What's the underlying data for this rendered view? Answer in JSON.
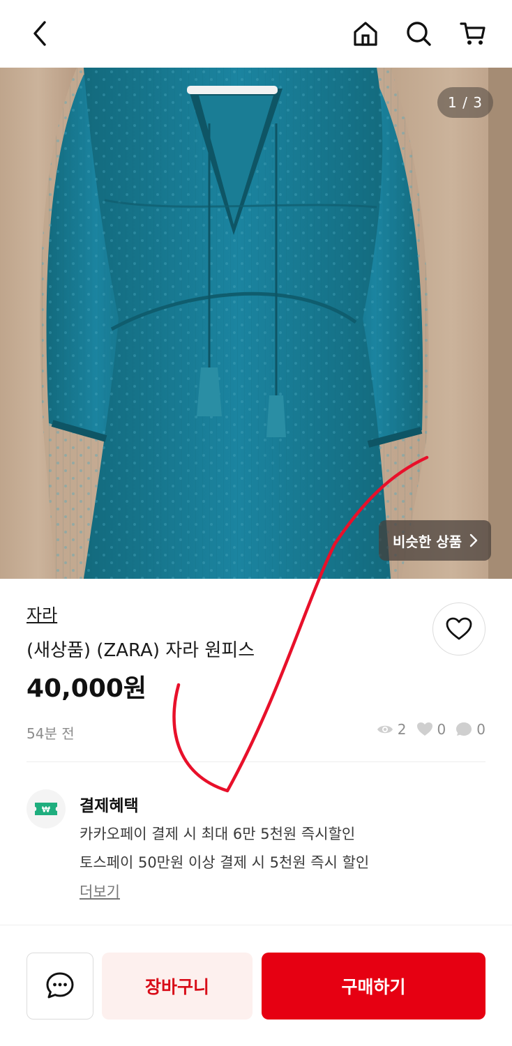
{
  "header": {
    "back_icon": "chevron-left-icon",
    "home_icon": "home-icon",
    "search_icon": "search-icon",
    "cart_icon": "cart-icon"
  },
  "gallery": {
    "counter": "1 / 3",
    "similar_label": "비슷한 상품",
    "similar_icon": "chevron-right-icon"
  },
  "product": {
    "brand": "자라",
    "title": "(새상품) (ZARA) 자라 원피스",
    "price": "40,000원",
    "posted": "54분 전",
    "views": "2",
    "likes": "0",
    "chats": "0"
  },
  "benefits": {
    "title": "결제혜택",
    "line1": "카카오페이 결제 시 최대 6만 5천원 즉시할인",
    "line2": "토스페이 50만원 이상 결제 시 5천원 즉시 할인",
    "more": "더보기"
  },
  "actions": {
    "cart_label": "장바구니",
    "buy_label": "구매하기"
  },
  "colors": {
    "accent": "#e60012",
    "cart_bg": "#fdf0ee",
    "dress": "#1b7f95"
  }
}
